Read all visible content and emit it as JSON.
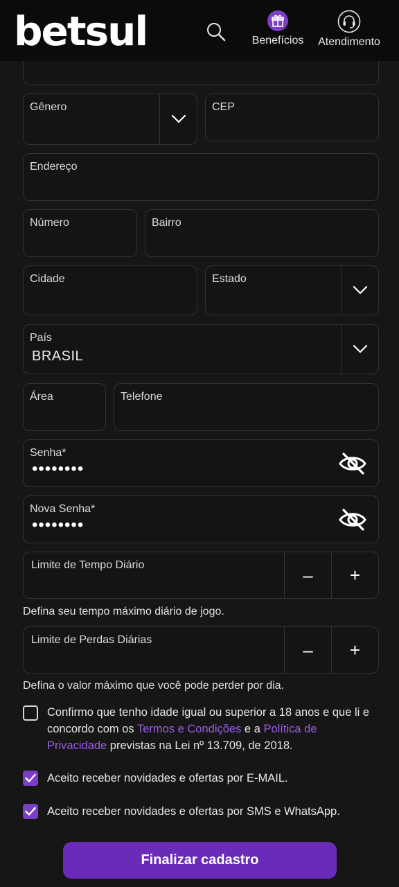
{
  "header": {
    "logo": "betsul",
    "benefits_label": "Benefícios",
    "support_label": "Atendimento"
  },
  "form": {
    "genero_label": "Gênero",
    "cep_label": "CEP",
    "endereco_label": "Endereço",
    "numero_label": "Número",
    "bairro_label": "Bairro",
    "cidade_label": "Cidade",
    "estado_label": "Estado",
    "pais_label": "País",
    "pais_value": "BRASIL",
    "area_label": "Área",
    "telefone_label": "Telefone",
    "senha_label": "Senha*",
    "senha_value": "••••••••",
    "nova_senha_label": "Nova Senha*",
    "nova_senha_value": "••••••••",
    "limite_tempo_label": "Limite de Tempo Diário",
    "limite_tempo_helper": "Defina seu tempo máximo diário de jogo.",
    "limite_perdas_label": "Limite de Perdas Diárias",
    "limite_perdas_helper": "Defina o valor máximo que você pode perder por dia.",
    "minus": "–",
    "plus": "+"
  },
  "consent": {
    "age_text_1": "Confirmo que tenho idade igual ou superior a 18 anos e que li e concordo com os ",
    "terms_link": "Termos e Condições",
    "age_text_2": " e a ",
    "privacy_link": "Política de Privacidade",
    "age_text_3": " previstas na Lei nº 13.709, de 2018.",
    "age_checked": false,
    "email_text": "Aceito receber novidades e ofertas por E-MAIL.",
    "email_checked": true,
    "sms_text": "Aceito receber novidades e ofertas por SMS e WhatsApp.",
    "sms_checked": true
  },
  "submit_label": "Finalizar cadastro",
  "colors": {
    "accent": "#7b3fc6",
    "button": "#6a2bb8",
    "link": "#9a5ce6",
    "background": "#161616",
    "header": "#0b0b0b"
  }
}
